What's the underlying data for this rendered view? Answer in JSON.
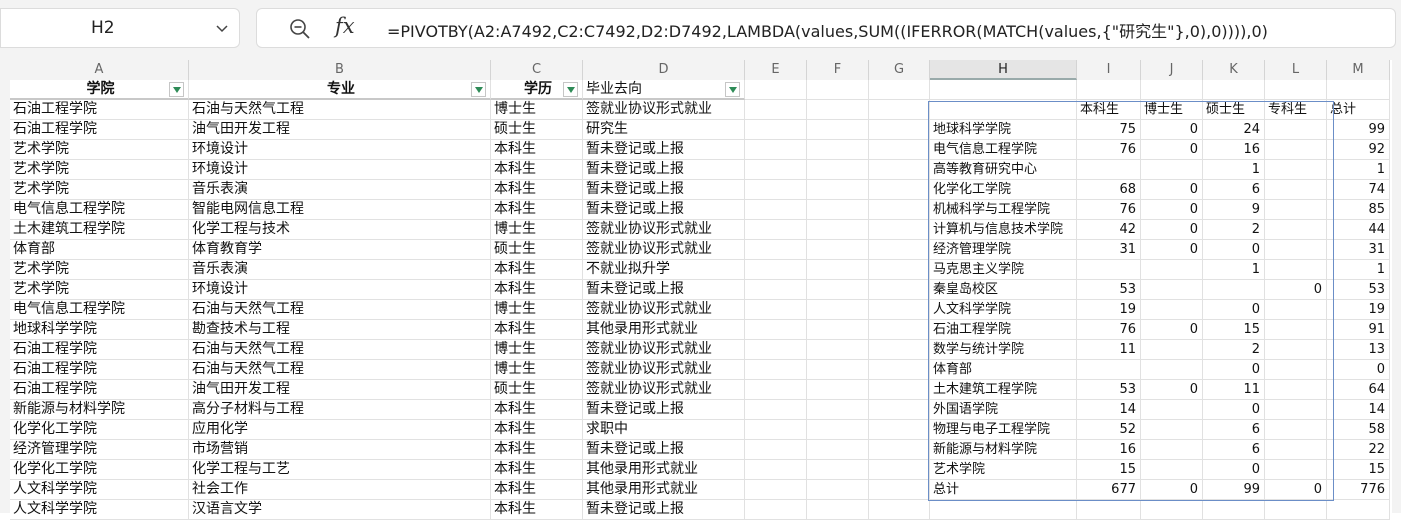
{
  "namebox": {
    "value": "H2"
  },
  "formula": {
    "text": "=PIVOTBY(A2:A7492,C2:C7492,D2:D7492,LAMBDA(values,SUM((IFERROR(MATCH(values,{\"研究生\"},0),0)))),0)"
  },
  "columns": [
    "A",
    "B",
    "C",
    "D",
    "E",
    "F",
    "G",
    "H",
    "I",
    "J",
    "K",
    "L",
    "M"
  ],
  "table": {
    "headers": [
      "学院",
      "专业",
      "学历",
      "毕业去向"
    ],
    "rows": [
      [
        "石油工程学院",
        "石油与天然气工程",
        "博士生",
        "签就业协议形式就业"
      ],
      [
        "石油工程学院",
        "油气田开发工程",
        "硕士生",
        "研究生"
      ],
      [
        "艺术学院",
        "环境设计",
        "本科生",
        "暂未登记或上报"
      ],
      [
        "艺术学院",
        "环境设计",
        "本科生",
        "暂未登记或上报"
      ],
      [
        "艺术学院",
        "音乐表演",
        "本科生",
        "暂未登记或上报"
      ],
      [
        "电气信息工程学院",
        "智能电网信息工程",
        "本科生",
        "暂未登记或上报"
      ],
      [
        "土木建筑工程学院",
        "化学工程与技术",
        "博士生",
        "签就业协议形式就业"
      ],
      [
        "体育部",
        "体育教育学",
        "硕士生",
        "签就业协议形式就业"
      ],
      [
        "艺术学院",
        "音乐表演",
        "本科生",
        "不就业拟升学"
      ],
      [
        "艺术学院",
        "环境设计",
        "本科生",
        "暂未登记或上报"
      ],
      [
        "电气信息工程学院",
        "石油与天然气工程",
        "博士生",
        "签就业协议形式就业"
      ],
      [
        "地球科学学院",
        "勘查技术与工程",
        "本科生",
        "其他录用形式就业"
      ],
      [
        "石油工程学院",
        "石油与天然气工程",
        "博士生",
        "签就业协议形式就业"
      ],
      [
        "石油工程学院",
        "石油与天然气工程",
        "博士生",
        "签就业协议形式就业"
      ],
      [
        "石油工程学院",
        "油气田开发工程",
        "硕士生",
        "签就业协议形式就业"
      ],
      [
        "新能源与材料学院",
        "高分子材料与工程",
        "本科生",
        "暂未登记或上报"
      ],
      [
        "化学化工学院",
        "应用化学",
        "本科生",
        "求职中"
      ],
      [
        "经济管理学院",
        "市场营销",
        "本科生",
        "暂未登记或上报"
      ],
      [
        "化学化工学院",
        "化学工程与工艺",
        "本科生",
        "其他录用形式就业"
      ],
      [
        "人文科学学院",
        "社会工作",
        "本科生",
        "其他录用形式就业"
      ],
      [
        "人文科学学院",
        "汉语言文学",
        "本科生",
        "暂未登记或上报"
      ]
    ]
  },
  "pivot": {
    "col_headers": [
      "本科生",
      "博士生",
      "硕士生",
      "专科生",
      "总计"
    ],
    "rows": [
      [
        "地球科学学院",
        "75",
        "0",
        "24",
        "",
        "99"
      ],
      [
        "电气信息工程学院",
        "76",
        "0",
        "16",
        "",
        "92"
      ],
      [
        "高等教育研究中心",
        "",
        "",
        "1",
        "",
        "1"
      ],
      [
        "化学化工学院",
        "68",
        "0",
        "6",
        "",
        "74"
      ],
      [
        "机械科学与工程学院",
        "76",
        "0",
        "9",
        "",
        "85"
      ],
      [
        "计算机与信息技术学院",
        "42",
        "0",
        "2",
        "",
        "44"
      ],
      [
        "经济管理学院",
        "31",
        "0",
        "0",
        "",
        "31"
      ],
      [
        "马克思主义学院",
        "",
        "",
        "1",
        "",
        "1"
      ],
      [
        "秦皇岛校区",
        "53",
        "",
        "",
        "0",
        "53"
      ],
      [
        "人文科学学院",
        "19",
        "",
        "0",
        "",
        "19"
      ],
      [
        "石油工程学院",
        "76",
        "0",
        "15",
        "",
        "91"
      ],
      [
        "数学与统计学院",
        "11",
        "",
        "2",
        "",
        "13"
      ],
      [
        "体育部",
        "",
        "",
        "0",
        "",
        "0"
      ],
      [
        "土木建筑工程学院",
        "53",
        "0",
        "11",
        "",
        "64"
      ],
      [
        "外国语学院",
        "14",
        "",
        "0",
        "",
        "14"
      ],
      [
        "物理与电子工程学院",
        "52",
        "",
        "6",
        "",
        "58"
      ],
      [
        "新能源与材料学院",
        "16",
        "",
        "6",
        "",
        "22"
      ],
      [
        "艺术学院",
        "15",
        "",
        "0",
        "",
        "15"
      ],
      [
        "总计",
        "677",
        "0",
        "99",
        "0",
        "776"
      ]
    ]
  }
}
